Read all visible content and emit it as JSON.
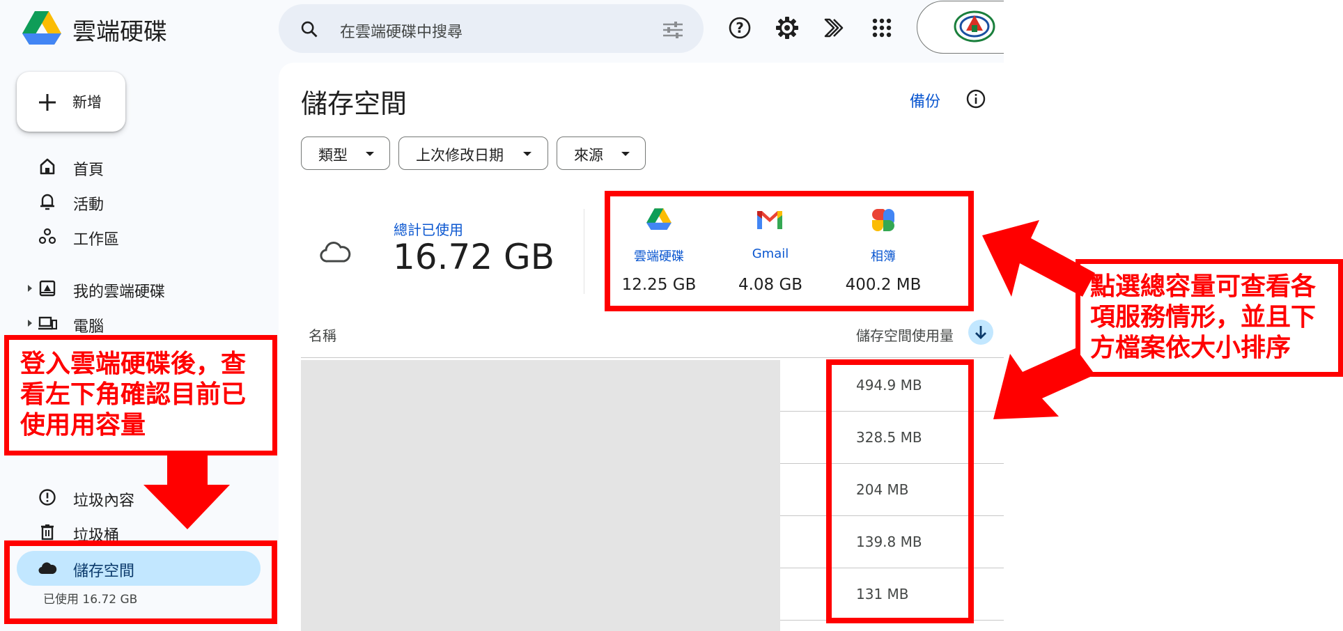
{
  "header": {
    "app_title": "雲端硬碟",
    "search_placeholder": "在雲端硬碟中搜尋"
  },
  "sidebar": {
    "new_label": "新增",
    "items": [
      {
        "label": "首頁"
      },
      {
        "label": "活動"
      },
      {
        "label": "工作區"
      },
      {
        "label": "我的雲端硬碟"
      },
      {
        "label": "電腦"
      },
      {
        "label": "垃圾內容"
      },
      {
        "label": "垃圾桶"
      },
      {
        "label": "儲存空間"
      }
    ],
    "storage_used": "已使用 16.72 GB"
  },
  "main": {
    "title": "儲存空間",
    "backup_link": "備份",
    "filters": [
      "類型",
      "上次修改日期",
      "來源"
    ],
    "total_label": "總計已使用",
    "total_value": "16.72 GB",
    "services": [
      {
        "name": "雲端硬碟",
        "value": "12.25 GB",
        "icon": "drive-icon"
      },
      {
        "name": "Gmail",
        "value": "4.08 GB",
        "icon": "gmail-icon"
      },
      {
        "name": "相簿",
        "value": "400.2 MB",
        "icon": "photos-icon"
      }
    ],
    "columns": {
      "name": "名稱",
      "storage": "儲存空間使用量"
    },
    "file_sizes": [
      "494.9 MB",
      "328.5 MB",
      "204 MB",
      "139.8 MB",
      "131 MB"
    ]
  },
  "annotations": {
    "left_note": [
      "登入雲端硬碟後，查",
      "看左下角確認目前已",
      "使用用容量"
    ],
    "right_note": [
      "點選總容量可查看各",
      "項服務情形，並且下",
      "方檔案依大小排序"
    ]
  },
  "colors": {
    "accent": "#0b57d0",
    "active_nav": "#c2e7ff",
    "annotation": "#ff0000"
  }
}
